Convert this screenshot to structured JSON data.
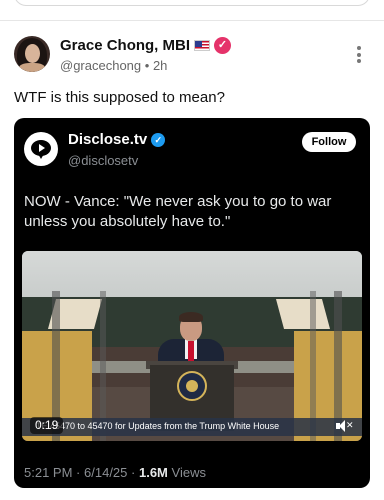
{
  "post": {
    "author_name": "Grace Chong, MBI",
    "flag_icon": "us-flag-icon",
    "verified_icon": "verified-badge-icon",
    "handle": "@gracechong",
    "separator": "•",
    "time": "2h",
    "text": "WTF is this supposed to mean?"
  },
  "embed": {
    "author_name": "Disclose.tv",
    "handle": "@disclosetv",
    "follow_label": "Follow",
    "text": "NOW - Vance: \"We never ask you to go to war unless you absolutely have to.\"",
    "video": {
      "timestamp": "0:19",
      "ticker": "TE 45470 to 45470 for Updates from the Trump White House"
    },
    "meta": {
      "time": "5:21 PM",
      "dot1": "·",
      "date": "6/14/25",
      "dot2": "·",
      "views_count": "1.6M",
      "views_label": "Views"
    }
  },
  "colors": {
    "verified_pink": "#e5336a",
    "verified_blue": "#1d9bf0",
    "embed_bg": "#000000"
  }
}
